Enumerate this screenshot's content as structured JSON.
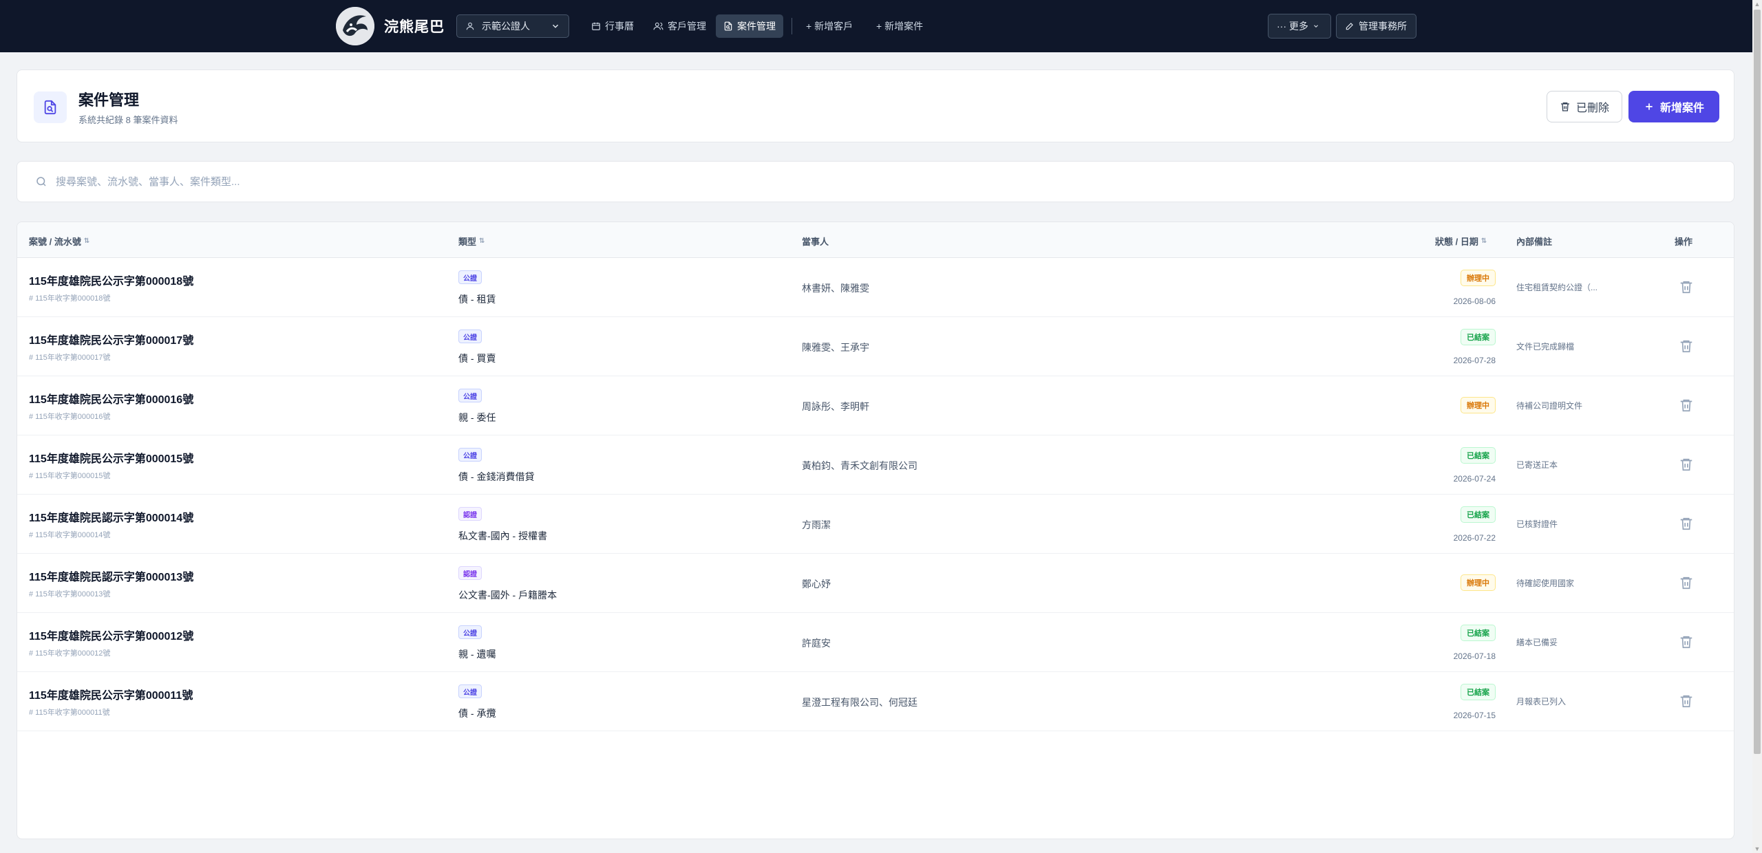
{
  "navbar": {
    "brand": "浣熊尾巴",
    "role": "示範公證人",
    "items": [
      {
        "label": "行事曆",
        "icon": "calendar-icon"
      },
      {
        "label": "客戶管理",
        "icon": "users-icon"
      },
      {
        "label": "案件管理",
        "icon": "file-search-icon",
        "active": true
      },
      {
        "label": "+ 新增客戶",
        "icon": ""
      },
      {
        "label": "+ 新增案件",
        "icon": ""
      }
    ],
    "more": "··· 更多",
    "manage": "管理事務所"
  },
  "header": {
    "title": "案件管理",
    "subtitle": "系統共紀錄 8 筆案件資料",
    "deleted_label": "已刪除",
    "new_case_label": "新增案件"
  },
  "search": {
    "placeholder": "搜尋案號、流水號、當事人、案件類型..."
  },
  "table": {
    "headers": {
      "case_no": "案號 / 流水號",
      "type": "類型",
      "parties": "當事人",
      "status": "狀態 / 日期",
      "note": "內部備註",
      "action": "操作"
    },
    "rows": [
      {
        "case_no": "115年度雄院民公示字第000018號",
        "serial": "# 115年收字第000018號",
        "badge": "公證",
        "badge_kind": "notary",
        "type": "債 - 租賃",
        "parties": "林書妍、陳雅雯",
        "status": "辦理中",
        "status_kind": "progress",
        "date": "2026-08-06",
        "note": "住宅租賃契約公證（..."
      },
      {
        "case_no": "115年度雄院民公示字第000017號",
        "serial": "# 115年收字第000017號",
        "badge": "公證",
        "badge_kind": "notary",
        "type": "債 - 買賣",
        "parties": "陳雅雯、王承宇",
        "status": "已結案",
        "status_kind": "done",
        "date": "2026-07-28",
        "note": "文件已完成歸檔"
      },
      {
        "case_no": "115年度雄院民公示字第000016號",
        "serial": "# 115年收字第000016號",
        "badge": "公證",
        "badge_kind": "notary",
        "type": "親 - 委任",
        "parties": "周詠彤、李明軒",
        "status": "辦理中",
        "status_kind": "progress",
        "date": "",
        "note": "待補公司證明文件"
      },
      {
        "case_no": "115年度雄院民公示字第000015號",
        "serial": "# 115年收字第000015號",
        "badge": "公證",
        "badge_kind": "notary",
        "type": "債 - 金錢消費借貸",
        "parties": "黃柏鈞、青禾文創有限公司",
        "status": "已結案",
        "status_kind": "done",
        "date": "2026-07-24",
        "note": "已寄送正本"
      },
      {
        "case_no": "115年度雄院民認示字第000014號",
        "serial": "# 115年收字第000014號",
        "badge": "認證",
        "badge_kind": "cert",
        "type": "私文書-國內 - 授權書",
        "parties": "方雨潔",
        "status": "已結案",
        "status_kind": "done",
        "date": "2026-07-22",
        "note": "已核對證件"
      },
      {
        "case_no": "115年度雄院民認示字第000013號",
        "serial": "# 115年收字第000013號",
        "badge": "認證",
        "badge_kind": "cert",
        "type": "公文書-國外 - 戶籍謄本",
        "parties": "鄭心妤",
        "status": "辦理中",
        "status_kind": "progress",
        "date": "",
        "note": "待確認使用國家"
      },
      {
        "case_no": "115年度雄院民公示字第000012號",
        "serial": "# 115年收字第000012號",
        "badge": "公證",
        "badge_kind": "notary",
        "type": "親 - 遺囑",
        "parties": "許庭安",
        "status": "已結案",
        "status_kind": "done",
        "date": "2026-07-18",
        "note": "繕本已備妥"
      },
      {
        "case_no": "115年度雄院民公示字第000011號",
        "serial": "# 115年收字第000011號",
        "badge": "公證",
        "badge_kind": "notary",
        "type": "債 - 承攬",
        "parties": "星澄工程有限公司、何冠廷",
        "status": "已結案",
        "status_kind": "done",
        "date": "2026-07-15",
        "note": "月報表已列入"
      }
    ]
  },
  "colors": {
    "navbar_bg": "#0f172a",
    "accent": "#4f46e5",
    "status_progress": "#d97706",
    "status_done": "#16a34a"
  }
}
